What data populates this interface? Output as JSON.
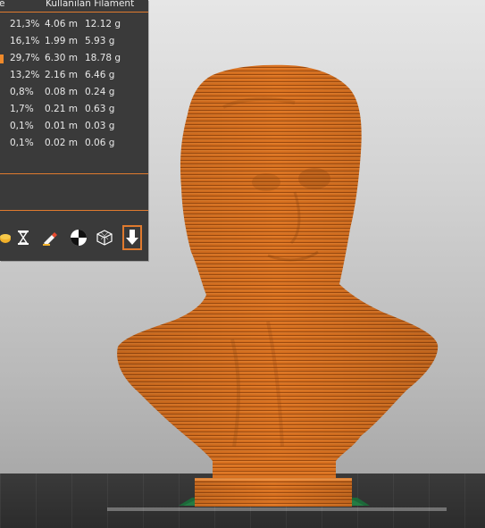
{
  "panel": {
    "header_left": "e",
    "header_right": "Kullanılan Filament",
    "rows": [
      {
        "percent": "21,3%",
        "length": "4.06 m",
        "weight": "12.12 g"
      },
      {
        "percent": "16,1%",
        "length": "1.99 m",
        "weight": "5.93 g"
      },
      {
        "percent": "29,7%",
        "length": "6.30 m",
        "weight": "18.78 g"
      },
      {
        "percent": "13,2%",
        "length": "2.16 m",
        "weight": "6.46 g"
      },
      {
        "percent": "0,8%",
        "length": "0.08 m",
        "weight": "0.24 g"
      },
      {
        "percent": "1,7%",
        "length": "0.21 m",
        "weight": "0.63 g"
      },
      {
        "percent": "0,1%",
        "length": "0.01 m",
        "weight": "0.03 g"
      },
      {
        "percent": "0,1%",
        "length": "0.02 m",
        "weight": "0.06 g"
      }
    ]
  },
  "toolbar": {
    "icons": [
      "layers-icon",
      "hourglass-icon",
      "paint-icon",
      "contrast-icon",
      "wireframe-cube-icon",
      "export-download-icon"
    ]
  },
  "colors": {
    "accent": "#e07a2e",
    "model": "#d0691c",
    "panel_bg": "#3a3a3a"
  }
}
